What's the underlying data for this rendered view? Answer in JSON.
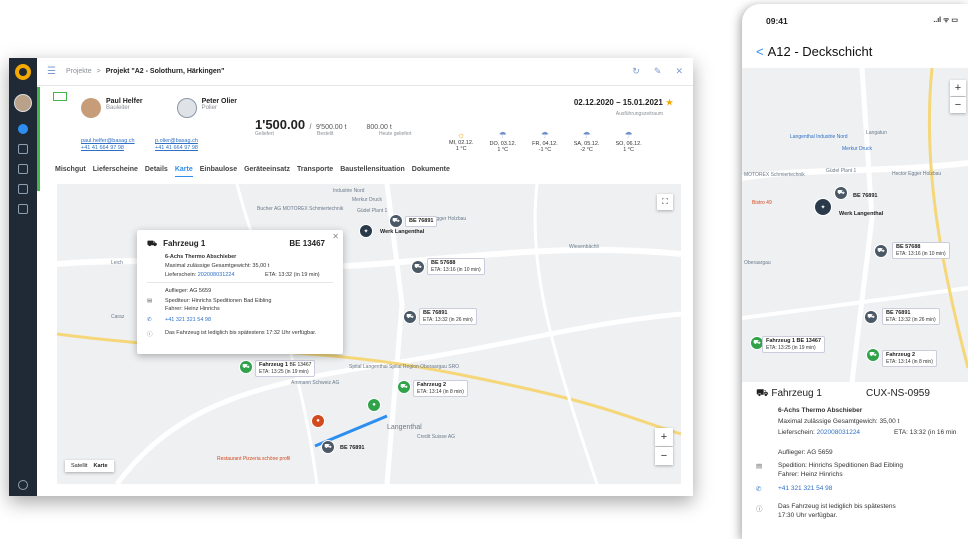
{
  "desktop": {
    "breadcrumb": {
      "root": "Projekte",
      "separator": ">",
      "current": "Projekt \"A2 - Solothurn, Härkingen\""
    },
    "people": [
      {
        "name": "Paul Helfer",
        "role": "Bauleiter",
        "email": "paul.helfer@basag.ch",
        "phone": "+41 41 664 97 98"
      },
      {
        "name": "Peter Olier",
        "role": "Polier",
        "email": "p.olier@basag.ch",
        "phone": "+41 41 664 97 98"
      }
    ],
    "quantity": {
      "delivered": "1'500.00",
      "slash": "/",
      "ordered": "9'500.00 t",
      "per_hour": "800.00 t"
    },
    "quantity_labels": {
      "delivered": "Geliefert",
      "ordered": "Bestellt",
      "per_hour": "Heute geliefert"
    },
    "dates": {
      "range": "02.12.2020 – 15.01.2021",
      "label": "Ausführungszeitraum"
    },
    "weather": [
      {
        "day": "MI, 02.12.",
        "temp": "1 °C",
        "icon": "sun-icon"
      },
      {
        "day": "DO, 03.12.",
        "temp": "1 °C",
        "icon": "cloud-icon"
      },
      {
        "day": "FR, 04.12.",
        "temp": "-1 °C",
        "icon": "cloud-icon"
      },
      {
        "day": "SA, 05.12.",
        "temp": "-2 °C",
        "icon": "cloud-icon"
      },
      {
        "day": "SO, 06.12.",
        "temp": "1 °C",
        "icon": "cloud-icon"
      }
    ],
    "tabs": [
      {
        "label": "Mischgut",
        "active": false
      },
      {
        "label": "Lieferscheine",
        "active": false
      },
      {
        "label": "Details",
        "active": false
      },
      {
        "label": "Karte",
        "active": true
      },
      {
        "label": "Einbaulose",
        "active": false
      },
      {
        "label": "Geräteeinsatz",
        "active": false
      },
      {
        "label": "Transporte",
        "active": false
      },
      {
        "label": "Baustellensituation",
        "active": false
      },
      {
        "label": "Dokumente",
        "active": false
      }
    ],
    "map": {
      "labels": [
        "Industrie Nord",
        "Merkur Druck",
        "Bucher AG MOTOREX Schmiertechnik",
        "Güdel Plant 1",
        "Hector Egger Holzbau",
        "Leich",
        "Spital Langenthal Spital Region Oberaargau SRO",
        "Ammann Schweiz AG",
        "Langenthal",
        "Credit Suisse AG",
        "Restaurant Pizzeria schöne profil",
        "Wiesenbächli",
        "Caraz"
      ],
      "werk_label": "Werk Langenthal",
      "trucks": [
        {
          "id": "BE 76891",
          "eta": ""
        },
        {
          "id": "BE 57688",
          "eta": "ETA: 13:16 (in 10 min)"
        },
        {
          "id": "BE 76891",
          "eta": "ETA: 13:32 (in 26 min)"
        },
        {
          "id": "Fahrzeug 1",
          "plate": "BE 13467",
          "eta": "ETA: 13:25 (in 19 min)"
        },
        {
          "id": "Fahrzeug 2",
          "eta": "ETA: 13:14 (in 8 min)"
        },
        {
          "id": "BE 76891",
          "eta": ""
        }
      ],
      "toggle": {
        "satellite": "Satellit",
        "map": "Karte"
      },
      "zoom_in": "+",
      "zoom_out": "−"
    },
    "popup": {
      "title": "Fahrzeug 1",
      "plate": "BE 13467",
      "type": "6-Achs Thermo Abschieber",
      "max_weight": "Maximal zulässige Gesamtgewicht: 35,00 t",
      "delivery_label": "Lieferschein:",
      "delivery_no": "202008031224",
      "eta": "ETA: 13:32 (in 19 min)",
      "trailer": "Auflieger: AG 5659",
      "forwarder": "Spediteur: Hinrichs Speditionen Bad Eibling",
      "driver": "Fahrer: Heinz Hinrichs",
      "phone": "+41 321 321 54 98",
      "note": "Das Fahrzeug ist lediglich bis spätestens 17:32 Uhr verfügbar."
    }
  },
  "phone": {
    "time": "09:41",
    "status": "..ıl ᯤ ▭",
    "title": "A12 - Deckschicht",
    "back": "<",
    "map": {
      "labels": [
        "Langenthal Industrie Nord",
        "Langatun",
        "Merkur Druck",
        "Güdel Plant 1",
        "Hector Egger Holzbau",
        "MOTOREX Schmiertechnik",
        "Bistro 49",
        "Oberaargau"
      ],
      "werk_label": "Werk Langenthal",
      "trucks": [
        {
          "id": "BE 76891",
          "eta": ""
        },
        {
          "id": "BE 57688",
          "eta": "ETA: 13:16 (in 10 min)"
        },
        {
          "id": "BE 76891",
          "eta": "ETA: 13:32 (in 26 min)"
        },
        {
          "id": "Fahrzeug 1  BE 13467",
          "eta": "ETA: 13:25 (in 19 min)"
        },
        {
          "id": "Fahrzeug 2",
          "eta": "ETA: 13:14 (in 8 min)"
        }
      ],
      "zoom_in": "+",
      "zoom_out": "−"
    },
    "card": {
      "title": "Fahrzeug 1",
      "plate": "CUX-NS-0959",
      "type": "6-Achs Thermo Abschieber",
      "max_weight": "Maximal zulässige Gesamtgewich: 35,00 t",
      "delivery_label": "Lieferschein:",
      "delivery_no": "202008031224",
      "eta": "ETA: 13:32 (in 16 min",
      "trailer": "Auflieger: AG 5659",
      "forwarder": "Spedition: Hinrichs Speditionen Bad Eibling",
      "driver": "Fahrer: Heinz Hinrichs",
      "phone": "+41 321 321 54 98",
      "note1": "Das Fahrzeug ist lediglich bis spätestens",
      "note2": "17:30 Uhr verfügbar."
    }
  },
  "colors": {
    "accent": "#2e8ef0",
    "green": "#43b649",
    "star": "#f2a900",
    "sidebar": "#1f2a36"
  }
}
